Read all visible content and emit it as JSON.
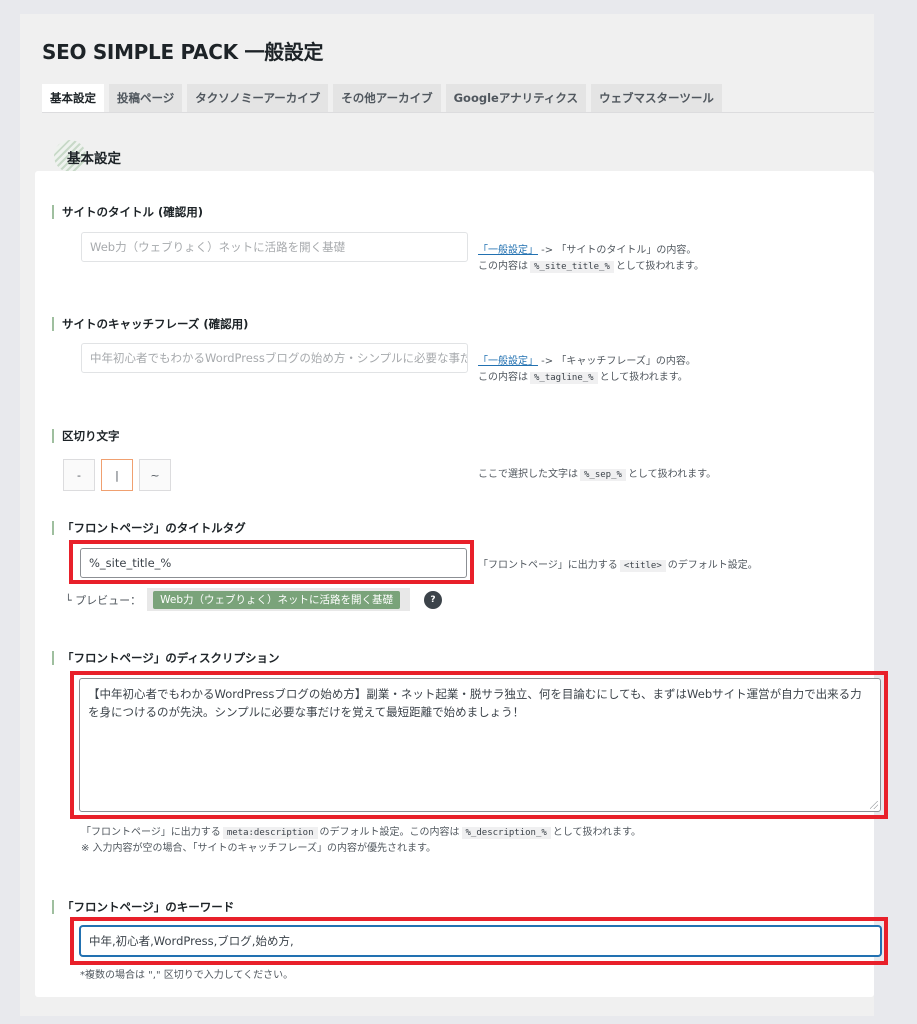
{
  "page": {
    "title": "SEO SIMPLE PACK 一般設定"
  },
  "tabs": [
    {
      "label": "基本設定",
      "active": true
    },
    {
      "label": "投稿ページ",
      "active": false
    },
    {
      "label": "タクソノミーアーカイブ",
      "active": false
    },
    {
      "label": "その他アーカイブ",
      "active": false
    },
    {
      "label": "Googleアナリティクス",
      "active": false
    },
    {
      "label": "ウェブマスターツール",
      "active": false
    }
  ],
  "section": {
    "title": "基本設定"
  },
  "site_title": {
    "label": "サイトのタイトル (確認用)",
    "placeholder": "Web力（ウェブりょく）ネットに活路を開く基礎",
    "help_link": "「一般設定」",
    "help_line1_rest": " -> 「サイトのタイトル」の内容。",
    "help_line2_pre": "この内容は",
    "help_code": "%_site_title_%",
    "help_line2_post": "として扱われます。"
  },
  "tagline": {
    "label": "サイトのキャッチフレーズ (確認用)",
    "placeholder": "中年初心者でもわかるWordPressブログの始め方・シンプルに必要な事だけ",
    "help_link": "「一般設定」",
    "help_line1_rest": " -> 「キャッチフレーズ」の内容。",
    "help_line2_pre": "この内容は",
    "help_code": "%_tagline_%",
    "help_line2_post": "として扱われます。"
  },
  "separator": {
    "label": "区切り文字",
    "options": [
      "-",
      "|",
      "~"
    ],
    "selected": "|",
    "help_pre": "ここで選択した文字は",
    "help_code": "%_sep_%",
    "help_post": "として扱われます。"
  },
  "front_title": {
    "label": "「フロントページ」のタイトルタグ",
    "value": "%_site_title_%",
    "help_pre": "「フロントページ」に出力する",
    "help_code": "<title>",
    "help_post": "のデフォルト設定。",
    "preview_label": "└ プレビュー：",
    "preview_value": "Web力（ウェブりょく）ネットに活路を開く基礎",
    "help_icon": "?"
  },
  "front_description": {
    "label": "「フロントページ」のディスクリプション",
    "value": "【中年初心者でもわかるWordPressブログの始め方】副業・ネット起業・脱サラ独立、何を目論むにしても、まずはWebサイト運営が自力で出来る力を身につけるのが先決。シンプルに必要な事だけを覚えて最短距離で始めましょう！",
    "note1_pre": "「フロントページ」に出力する",
    "note1_code1": "meta:description",
    "note1_mid": "のデフォルト設定。この内容は",
    "note1_code2": "%_description_%",
    "note1_post": "として扱われます。",
    "note2": "※ 入力内容が空の場合、「サイトのキャッチフレーズ」の内容が優先されます。"
  },
  "front_keywords": {
    "label": "「フロントページ」のキーワード",
    "value": "中年,初心者,WordPress,ブログ,始め方,",
    "note": "*複数の場合は \",\" 区切りで入力してください。"
  },
  "colors": {
    "highlight": "#e8202a",
    "accent": "#2271b1",
    "preview_pill": "#7aa37a",
    "separator_selected": "#f0a070"
  }
}
